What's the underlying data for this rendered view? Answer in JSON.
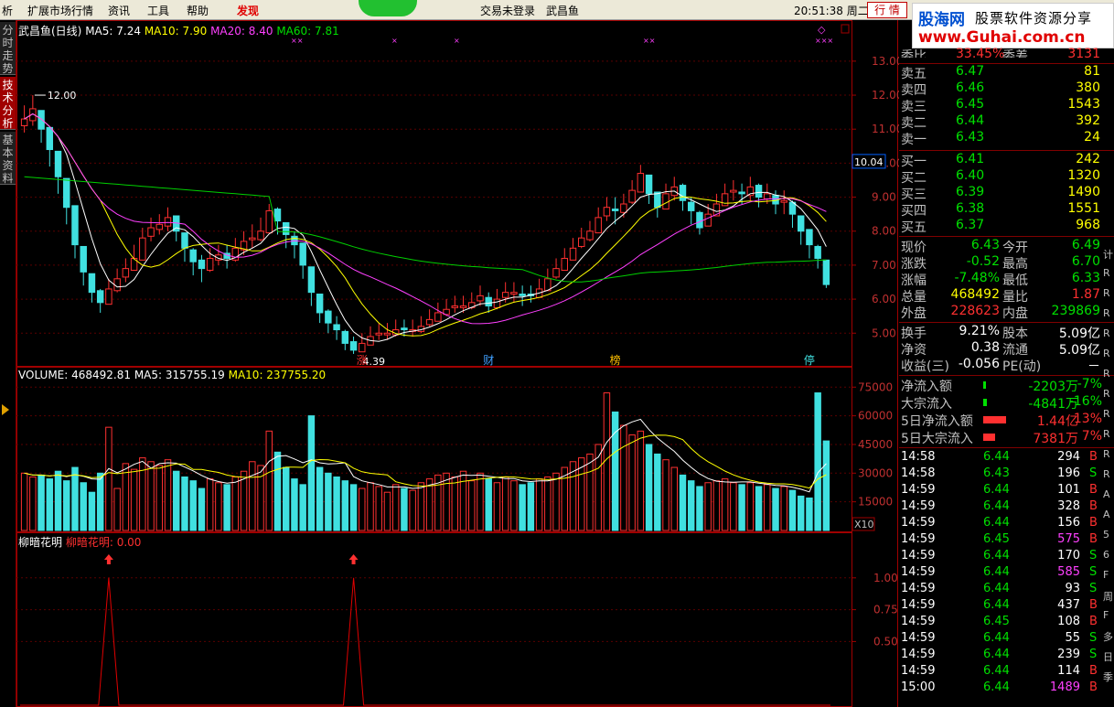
{
  "menu": {
    "items": [
      "析",
      "扩展市场行情",
      "资讯",
      "工具",
      "帮助",
      "发现"
    ],
    "center_left": "交易未登录",
    "center_right": "武昌鱼",
    "clock": "20:51:38 周二",
    "quote_tab": "行 情"
  },
  "logo": {
    "brand": "股海网",
    "tagline": "股票软件资源分享",
    "url": "www.Guhai.com.cn"
  },
  "left_tabs": [
    "分时走势",
    "技术分析",
    "基本资料"
  ],
  "price_panel": {
    "title": "武昌鱼(日线)",
    "ma5_label": "MA5: 7.24",
    "ma10_label": "MA10: 7.90",
    "ma20_label": "MA20: 8.40",
    "ma60_label": "MA60: 7.81",
    "high_label": "12.00",
    "low_label": "4.39",
    "current_price_tag": "10.04",
    "y_ticks": [
      "13.00",
      "12.00",
      "11.00",
      "10.00",
      "9.00",
      "8.00",
      "7.00",
      "6.00",
      "5.00"
    ],
    "event_markers": [
      "涨",
      "财",
      "榜",
      "停"
    ],
    "colors": {
      "ma5": "#ffffff",
      "ma10": "#ffff00",
      "ma20": "#ff40ff",
      "ma60": "#00d000",
      "up": "#ff3030",
      "down": "#40e0e0"
    }
  },
  "volume_panel": {
    "title": "VOLUME: 468492.81",
    "ma5_label": "MA5: 315755.19",
    "ma10_label": "MA10: 237755.20",
    "y_ticks": [
      "75000",
      "60000",
      "45000",
      "30000",
      "15000"
    ],
    "unit": "X10"
  },
  "indicator_panel": {
    "name": "柳暗花明",
    "value_label": "柳暗花明: 0.00",
    "y_ticks": [
      "1.00",
      "0.75",
      "0.50"
    ]
  },
  "chart_data": [
    {
      "type": "candlestick",
      "title": "武昌鱼(日线)",
      "ylim": [
        4.2,
        13.4
      ],
      "close": [
        11.3,
        11.6,
        11.0,
        10.4,
        9.6,
        8.7,
        7.6,
        6.8,
        6.2,
        5.9,
        6.3,
        6.6,
        6.9,
        7.2,
        7.8,
        8.1,
        8.2,
        8.4,
        8.0,
        7.5,
        7.1,
        6.9,
        7.2,
        7.3,
        7.2,
        7.5,
        7.7,
        7.8,
        8.0,
        8.6,
        8.3,
        7.9,
        7.6,
        7.0,
        6.2,
        5.6,
        5.3,
        5.1,
        4.7,
        4.5,
        4.7,
        4.9,
        5.0,
        5.0,
        5.1,
        5.1,
        5.1,
        5.2,
        5.4,
        5.6,
        5.7,
        5.8,
        5.8,
        5.9,
        6.1,
        5.8,
        6.0,
        6.2,
        6.2,
        6.1,
        6.1,
        6.3,
        6.6,
        6.9,
        7.2,
        7.5,
        7.8,
        8.0,
        8.4,
        8.7,
        8.6,
        8.8,
        9.2,
        9.7,
        9.1,
        8.7,
        9.1,
        9.3,
        8.9,
        8.6,
        8.1,
        8.5,
        8.8,
        9.1,
        9.2,
        9.1,
        9.3,
        9.0,
        9.1,
        8.8,
        8.9,
        8.5,
        8.0,
        7.6,
        7.2,
        6.43
      ],
      "high": [
        11.7,
        12.0,
        11.4,
        10.9,
        10.1,
        9.2,
        8.2,
        7.2,
        6.6,
        6.3,
        6.6,
        6.9,
        7.2,
        7.6,
        8.1,
        8.4,
        8.5,
        8.7,
        8.4,
        7.9,
        7.5,
        7.3,
        7.5,
        7.6,
        7.6,
        7.8,
        8.0,
        8.2,
        8.4,
        8.8,
        8.7,
        8.2,
        8.0,
        7.5,
        6.8,
        6.0,
        5.7,
        5.5,
        5.1,
        4.9,
        5.0,
        5.2,
        5.3,
        5.3,
        5.4,
        5.4,
        5.4,
        5.5,
        5.7,
        5.9,
        6.0,
        6.1,
        6.1,
        6.2,
        6.4,
        6.2,
        6.3,
        6.5,
        6.5,
        6.4,
        6.4,
        6.6,
        6.9,
        7.2,
        7.5,
        7.8,
        8.1,
        8.3,
        8.7,
        9.0,
        9.0,
        9.1,
        9.5,
        9.95,
        9.6,
        9.1,
        9.4,
        9.6,
        9.4,
        9.0,
        8.6,
        8.8,
        9.1,
        9.4,
        9.5,
        9.4,
        9.6,
        9.4,
        9.4,
        9.2,
        9.2,
        8.9,
        8.4,
        8.0,
        7.6,
        7.0
      ],
      "low": [
        10.9,
        11.1,
        10.6,
        9.9,
        9.1,
        8.2,
        7.2,
        6.4,
        5.9,
        5.6,
        5.9,
        6.2,
        6.5,
        6.9,
        7.4,
        7.7,
        7.9,
        8.0,
        7.7,
        7.1,
        6.7,
        6.5,
        6.8,
        7.0,
        6.9,
        7.1,
        7.3,
        7.5,
        7.7,
        8.1,
        7.9,
        7.5,
        7.2,
        6.6,
        5.8,
        5.3,
        5.0,
        4.8,
        4.5,
        4.39,
        4.5,
        4.7,
        4.8,
        4.8,
        4.9,
        4.9,
        4.9,
        5.0,
        5.2,
        5.4,
        5.5,
        5.6,
        5.6,
        5.7,
        5.8,
        5.6,
        5.7,
        5.9,
        5.9,
        5.8,
        5.9,
        6.1,
        6.3,
        6.6,
        6.9,
        7.2,
        7.5,
        7.7,
        8.1,
        8.3,
        8.2,
        8.4,
        8.8,
        9.2,
        8.8,
        8.4,
        8.7,
        8.9,
        8.6,
        8.2,
        7.9,
        8.2,
        8.5,
        8.8,
        8.9,
        8.8,
        8.9,
        8.7,
        8.8,
        8.5,
        8.5,
        8.1,
        7.6,
        7.2,
        6.9,
        6.33
      ],
      "series": [
        {
          "name": "MA5",
          "last": 7.24
        },
        {
          "name": "MA10",
          "last": 7.9
        },
        {
          "name": "MA20",
          "last": 8.4
        },
        {
          "name": "MA60",
          "last": 7.81
        }
      ],
      "annotations": [
        {
          "text": "12.00"
        },
        {
          "text": "4.39"
        }
      ]
    },
    {
      "type": "bar",
      "title": "VOLUME",
      "ylim": [
        0,
        78000
      ],
      "values": [
        30000,
        28000,
        29000,
        27000,
        31000,
        26000,
        33000,
        25000,
        20000,
        30000,
        54000,
        22000,
        35000,
        32000,
        38000,
        36000,
        34000,
        37000,
        31000,
        28000,
        26000,
        22000,
        27000,
        25000,
        24000,
        28000,
        31000,
        36000,
        34000,
        52000,
        41000,
        33000,
        27000,
        24000,
        60000,
        33000,
        30000,
        28000,
        26000,
        24000,
        22000,
        25000,
        23000,
        20000,
        24000,
        22000,
        21000,
        25000,
        27000,
        29000,
        30000,
        28000,
        31000,
        26000,
        30000,
        27000,
        25000,
        28000,
        26000,
        24000,
        25000,
        27000,
        28000,
        30000,
        33000,
        36000,
        38000,
        40000,
        45000,
        72000,
        62000,
        55000,
        50000,
        52000,
        45000,
        40000,
        37000,
        33000,
        29000,
        26000,
        23000,
        25000,
        26000,
        27000,
        25000,
        24000,
        25000,
        23000,
        24000,
        22000,
        23000,
        21000,
        18000,
        17000,
        72000,
        46850
      ],
      "series": [
        {
          "name": "MA5",
          "last": 31575.5
        },
        {
          "name": "MA10",
          "last": 23775.5
        }
      ]
    },
    {
      "type": "line",
      "title": "柳暗花明",
      "ylim": [
        0,
        1.25
      ],
      "spikes_at_index": [
        10,
        39
      ],
      "spike_value": 1.0
    }
  ],
  "quote": {
    "header_partial": [
      {
        "label": "委比",
        "value": "33.45%"
      },
      {
        "label": "委差",
        "value": "3131"
      }
    ],
    "asks": [
      {
        "label": "卖五",
        "price": "6.47",
        "vol": "81"
      },
      {
        "label": "卖四",
        "price": "6.46",
        "vol": "380"
      },
      {
        "label": "卖三",
        "price": "6.45",
        "vol": "1543"
      },
      {
        "label": "卖二",
        "price": "6.44",
        "vol": "392"
      },
      {
        "label": "卖一",
        "price": "6.43",
        "vol": "24"
      }
    ],
    "bids": [
      {
        "label": "买一",
        "price": "6.41",
        "vol": "242"
      },
      {
        "label": "买二",
        "price": "6.40",
        "vol": "1320"
      },
      {
        "label": "买三",
        "price": "6.39",
        "vol": "1490"
      },
      {
        "label": "买四",
        "price": "6.38",
        "vol": "1551"
      },
      {
        "label": "买五",
        "price": "6.37",
        "vol": "968"
      }
    ],
    "stats": [
      {
        "l1": "现价",
        "v1": "6.43",
        "c1": "green",
        "l2": "今开",
        "v2": "6.49",
        "c2": "green"
      },
      {
        "l1": "涨跌",
        "v1": "-0.52",
        "c1": "green",
        "l2": "最高",
        "v2": "6.70",
        "c2": "green"
      },
      {
        "l1": "涨幅",
        "v1": "-7.48%",
        "c1": "green",
        "l2": "最低",
        "v2": "6.33",
        "c2": "green"
      },
      {
        "l1": "总量",
        "v1": "468492",
        "c1": "yellow",
        "l2": "量比",
        "v2": "1.87",
        "c2": "red"
      },
      {
        "l1": "外盘",
        "v1": "228623",
        "c1": "red",
        "l2": "内盘",
        "v2": "239869",
        "c2": "green"
      }
    ],
    "stats2": [
      {
        "l1": "换手",
        "v1": "9.21%",
        "l2": "股本",
        "v2": "5.09亿"
      },
      {
        "l1": "净资",
        "v1": "0.38",
        "l2": "流通",
        "v2": "5.09亿"
      },
      {
        "l1": "收益(三)",
        "v1": "-0.056",
        "l2": "PE(动)",
        "v2": "－"
      }
    ],
    "flows": [
      {
        "label": "净流入额",
        "value": "-2203万",
        "pct": "-7%",
        "color": "green",
        "bar": 0.04
      },
      {
        "label": "大宗流入",
        "value": "-4841万",
        "pct": "-16%",
        "color": "green",
        "bar": 0.1
      },
      {
        "label": "5日净流入额",
        "value": "1.44亿",
        "pct": "13%",
        "color": "red",
        "bar": 0.7
      },
      {
        "label": "5日大宗流入",
        "value": "7381万",
        "pct": "7%",
        "color": "red",
        "bar": 0.35
      }
    ],
    "ticks": [
      {
        "time": "14:58",
        "price": "6.44",
        "vol": "294",
        "side": "B",
        "pc": "green",
        "vc": "white"
      },
      {
        "time": "14:58",
        "price": "6.43",
        "vol": "196",
        "side": "S",
        "pc": "green",
        "vc": "white"
      },
      {
        "time": "14:59",
        "price": "6.44",
        "vol": "101",
        "side": "B",
        "pc": "green",
        "vc": "white"
      },
      {
        "time": "14:59",
        "price": "6.44",
        "vol": "328",
        "side": "B",
        "pc": "green",
        "vc": "white"
      },
      {
        "time": "14:59",
        "price": "6.44",
        "vol": "156",
        "side": "B",
        "pc": "green",
        "vc": "white"
      },
      {
        "time": "14:59",
        "price": "6.45",
        "vol": "575",
        "side": "B",
        "pc": "green",
        "vc": "magenta"
      },
      {
        "time": "14:59",
        "price": "6.44",
        "vol": "170",
        "side": "S",
        "pc": "green",
        "vc": "white"
      },
      {
        "time": "14:59",
        "price": "6.44",
        "vol": "585",
        "side": "S",
        "pc": "green",
        "vc": "magenta"
      },
      {
        "time": "14:59",
        "price": "6.44",
        "vol": "93",
        "side": "S",
        "pc": "green",
        "vc": "white"
      },
      {
        "time": "14:59",
        "price": "6.44",
        "vol": "437",
        "side": "B",
        "pc": "green",
        "vc": "white"
      },
      {
        "time": "14:59",
        "price": "6.45",
        "vol": "108",
        "side": "B",
        "pc": "green",
        "vc": "white"
      },
      {
        "time": "14:59",
        "price": "6.44",
        "vol": "55",
        "side": "S",
        "pc": "green",
        "vc": "white"
      },
      {
        "time": "14:59",
        "price": "6.44",
        "vol": "239",
        "side": "S",
        "pc": "green",
        "vc": "white"
      },
      {
        "time": "14:59",
        "price": "6.44",
        "vol": "114",
        "side": "B",
        "pc": "green",
        "vc": "white"
      },
      {
        "time": "15:00",
        "price": "6.44",
        "vol": "1489",
        "side": "B",
        "pc": "green",
        "vc": "magenta"
      }
    ]
  },
  "right_strip": [
    "计",
    "R",
    "R",
    "R",
    "R",
    "R",
    "R",
    "R",
    "R",
    "R",
    "R",
    "R",
    "A",
    "A",
    "5",
    "6",
    "F",
    "周",
    "F",
    "多",
    "日",
    "季"
  ]
}
